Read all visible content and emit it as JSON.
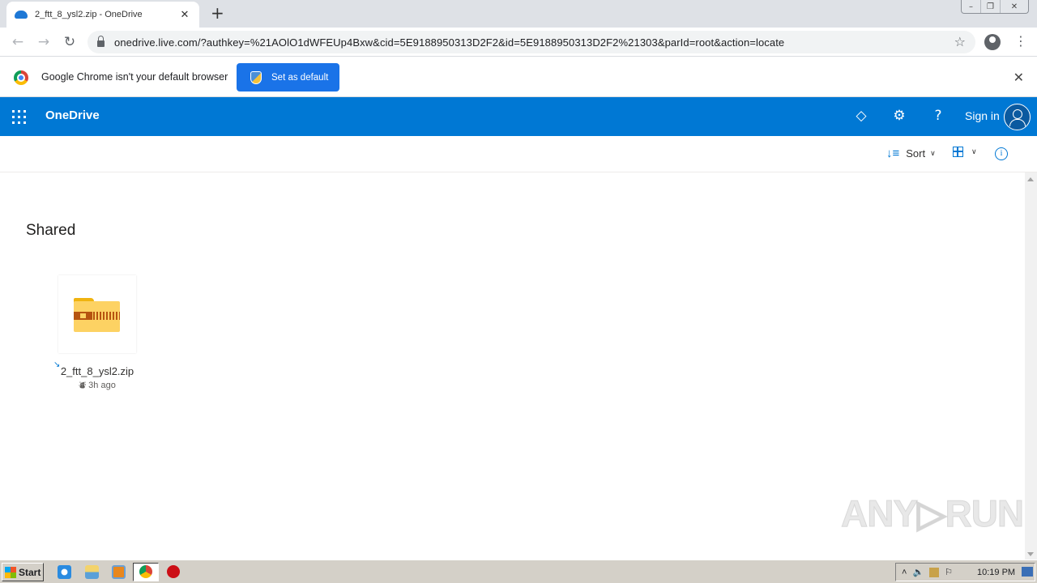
{
  "browser": {
    "tab": {
      "title": "2_ftt_8_ysl2.zip - OneDrive",
      "favicon": "onedrive-cloud-icon"
    },
    "new_tab_label": "+",
    "window_controls": {
      "minimize": "–",
      "restore": "❐",
      "close": "✕"
    },
    "nav": {
      "back": "←",
      "forward": "→",
      "reload": "↻"
    },
    "url": "onedrive.live.com/?authkey=%21AOlO1dWFEUp4Bxw&cid=5E9188950313D2F2&id=5E9188950313D2F2%21303&parId=root&action=locate",
    "bookmark_icon": "☆",
    "menu_icon": "⋮"
  },
  "infobar": {
    "message": "Google Chrome isn't your default browser",
    "button_label": "Set as default",
    "close": "✕"
  },
  "onedrive": {
    "brand": "OneDrive",
    "header_icons": {
      "premium": "◇",
      "settings": "⚙",
      "help": "?"
    },
    "sign_in": "Sign in",
    "accent": "#0078d4",
    "commands": {
      "sort_label": "Sort",
      "sort_icon": "↓≡",
      "chevron": "∨",
      "info": "i"
    },
    "page_title": "Shared",
    "files": [
      {
        "name": "2_ftt_8_ysl2.zip",
        "modified": "3h ago",
        "type": "zip",
        "shortcut_icon": "↘",
        "shared_icon": "⛇"
      }
    ]
  },
  "watermark": "ANY▷RUN",
  "taskbar": {
    "start_label": "Start",
    "clock": "10:19 PM",
    "tray": {
      "expand": "˄",
      "volume": "🔈",
      "flag": "⚐"
    }
  }
}
